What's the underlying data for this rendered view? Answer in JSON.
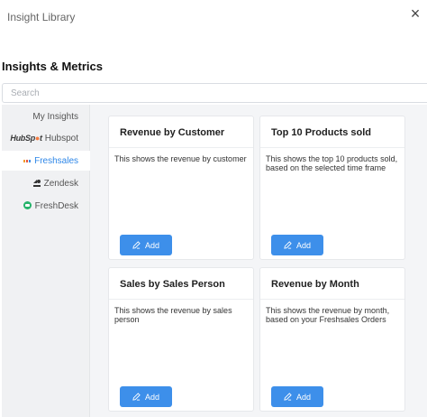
{
  "window": {
    "title": "Insight Library",
    "close_glyph": "×"
  },
  "heading": "Insights & Metrics",
  "search": {
    "placeholder": "Search"
  },
  "sidebar": {
    "items": [
      {
        "label": "My Insights",
        "icon": ""
      },
      {
        "label": "Hubspot",
        "icon": "hubspot-logo",
        "logo_text_a": "HubSp",
        "logo_text_b": "t"
      },
      {
        "label": "Freshsales",
        "icon": "freshsales-logo",
        "active": true
      },
      {
        "label": "Zendesk",
        "icon": "zendesk-logo"
      },
      {
        "label": "FreshDesk",
        "icon": "freshdesk-logo"
      }
    ]
  },
  "cards": [
    {
      "title": "Revenue by Customer",
      "description": "This shows the revenue by customer",
      "button": "Add"
    },
    {
      "title": "Top 10 Products sold",
      "description": "This shows the top 10 products sold, based on the selected time frame",
      "button": "Add"
    },
    {
      "title": "Sales by Sales Person",
      "description": "This shows the revenue by sales person",
      "button": "Add"
    },
    {
      "title": "Revenue by Month",
      "description": "This shows the revenue by month, based on your Freshsales Orders",
      "button": "Add"
    }
  ],
  "colors": {
    "accent": "#3d8fea",
    "active_link": "#2e87e8",
    "sidebar_bg": "#f0f1f3",
    "main_bg": "#f4f5f7"
  }
}
